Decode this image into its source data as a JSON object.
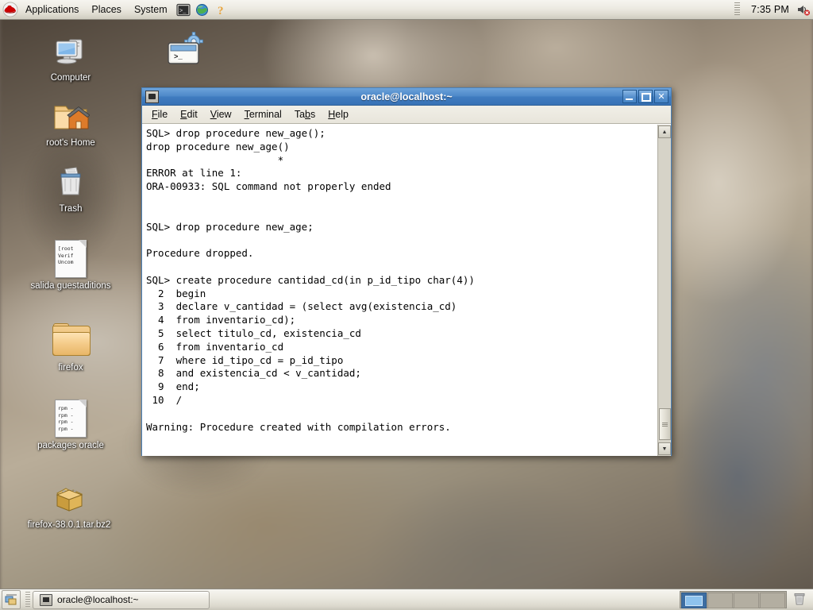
{
  "desktop": {
    "environment": "GNOME",
    "icons": [
      {
        "name": "computer",
        "label": "Computer",
        "type": "computer"
      },
      {
        "name": "home",
        "label": "root's Home",
        "type": "home-folder"
      },
      {
        "name": "trash",
        "label": "Trash",
        "type": "trash"
      },
      {
        "name": "salida-guestaditions",
        "label": "salida guestaditions",
        "type": "text-file",
        "preview": "[root\nVerif\nUncom"
      },
      {
        "name": "firefox-folder",
        "label": "firefox",
        "type": "folder"
      },
      {
        "name": "packages-oracle",
        "label": "packages oracle",
        "type": "text-file",
        "preview": "rpm -\nrpm -\nrpm -\nrpm -"
      },
      {
        "name": "firefox-archive",
        "label": "firefox-38.0.1.tar.bz2",
        "type": "archive"
      }
    ],
    "launcher_shortcut": {
      "name": "terminal-settings-shortcut",
      "label": ""
    }
  },
  "top_panel": {
    "logo": "redhat-logo",
    "menus": [
      {
        "label": "Applications"
      },
      {
        "label": "Places"
      },
      {
        "label": "System"
      }
    ],
    "launchers": [
      {
        "name": "terminal-launcher-icon"
      },
      {
        "name": "web-browser-launcher-icon"
      },
      {
        "name": "help-launcher-icon"
      }
    ],
    "clock": "7:35 PM",
    "volume_icon": "speaker-muted-icon"
  },
  "window": {
    "title": "oracle@localhost:~",
    "icon": "terminal-icon",
    "controls": {
      "minimize": "–",
      "maximize": "□",
      "close": "✕"
    },
    "menubar": [
      {
        "label": "File",
        "mnemonic": "F"
      },
      {
        "label": "Edit",
        "mnemonic": "E"
      },
      {
        "label": "View",
        "mnemonic": "V"
      },
      {
        "label": "Terminal",
        "mnemonic": "T"
      },
      {
        "label": "Tabs",
        "mnemonic": "b"
      },
      {
        "label": "Help",
        "mnemonic": "H"
      }
    ],
    "terminal_text": "SQL> drop procedure new_age();\ndrop procedure new_age()\n                      *\nERROR at line 1:\nORA-00933: SQL command not properly ended\n\n\nSQL> drop procedure new_age;\n\nProcedure dropped.\n\nSQL> create procedure cantidad_cd(in p_id_tipo char(4))\n  2  begin\n  3  declare v_cantidad = (select avg(existencia_cd)\n  4  from inventario_cd);\n  5  select titulo_cd, existencia_cd\n  6  from inventario_cd\n  7  where id_tipo_cd = p_id_tipo\n  8  and existencia_cd < v_cantidad;\n  9  end;\n 10  /\n\nWarning: Procedure created with compilation errors.",
    "scrollbar": {
      "position": "bottom"
    }
  },
  "bottom_panel": {
    "show_desktop": "show-desktop-button",
    "tasks": [
      {
        "label": "oracle@localhost:~",
        "active": true,
        "icon": "terminal-icon"
      }
    ],
    "workspaces": [
      {
        "index": 1,
        "active": true
      },
      {
        "index": 2,
        "active": false
      },
      {
        "index": 3,
        "active": false
      },
      {
        "index": 4,
        "active": false
      }
    ],
    "trash_applet": "trash-applet-icon"
  },
  "colors": {
    "title_bar": "#3f7cc0",
    "panel": "#eceae1",
    "terminal_bg": "#ffffff",
    "terminal_fg": "#000000",
    "workspace_active": "#3d6ea3"
  }
}
